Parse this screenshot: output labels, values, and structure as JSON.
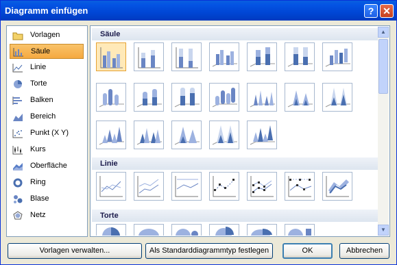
{
  "window": {
    "title": "Diagramm einfügen",
    "help_glyph": "?",
    "close_glyph": "✕"
  },
  "sidebar": {
    "items": [
      {
        "label": "Vorlagen",
        "icon": "folder-icon"
      },
      {
        "label": "Säule",
        "icon": "column-chart-icon",
        "selected": true
      },
      {
        "label": "Linie",
        "icon": "line-chart-icon"
      },
      {
        "label": "Torte",
        "icon": "pie-chart-icon"
      },
      {
        "label": "Balken",
        "icon": "bar-chart-icon"
      },
      {
        "label": "Bereich",
        "icon": "area-chart-icon"
      },
      {
        "label": "Punkt (X Y)",
        "icon": "scatter-chart-icon"
      },
      {
        "label": "Kurs",
        "icon": "stock-chart-icon"
      },
      {
        "label": "Oberfläche",
        "icon": "surface-chart-icon"
      },
      {
        "label": "Ring",
        "icon": "doughnut-chart-icon"
      },
      {
        "label": "Blase",
        "icon": "bubble-chart-icon"
      },
      {
        "label": "Netz",
        "icon": "radar-chart-icon"
      }
    ]
  },
  "gallery": {
    "sections": [
      {
        "title": "Säule"
      },
      {
        "title": "Linie"
      },
      {
        "title": "Torte"
      }
    ],
    "selected_thumbnail": "Säule 1"
  },
  "footer": {
    "manage_templates": "Vorlagen verwalten...",
    "set_default": "Als Standarddiagrammtyp festlegen",
    "ok": "OK",
    "cancel": "Abbrechen"
  },
  "colors": {
    "title_bar": "#0046d5",
    "selection": "#f5a940",
    "accent_blue": "#4a6fb0"
  }
}
